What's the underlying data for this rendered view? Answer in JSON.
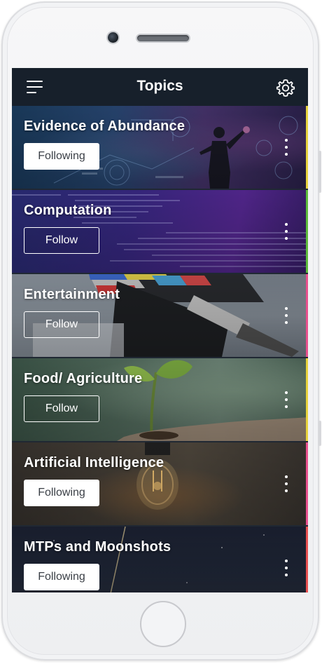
{
  "header": {
    "title": "Topics",
    "menu_icon": "hamburger-menu-icon",
    "settings_icon": "gear-icon",
    "background": "#17202b"
  },
  "topics": [
    {
      "title": "Evidence of Abundance",
      "button_label": "Following",
      "following": true,
      "accent": "#e7d23c",
      "theme": "futuristic-ui-woman"
    },
    {
      "title": "Computation",
      "button_label": "Follow",
      "following": false,
      "accent": "#5cbc3b",
      "theme": "purple-code-screen"
    },
    {
      "title": "Entertainment",
      "button_label": "Follow",
      "following": false,
      "accent": "#e8508e",
      "theme": "film-clapperboard"
    },
    {
      "title": "Food/ Agriculture",
      "button_label": "Follow",
      "following": false,
      "accent": "#e7d23c",
      "theme": "seedling-in-hand"
    },
    {
      "title": "Artificial Intelligence",
      "button_label": "Following",
      "following": true,
      "accent": "#e8508e",
      "theme": "light-bulb"
    },
    {
      "title": "MTPs and Moonshots",
      "button_label": "Following",
      "following": true,
      "accent": "#e85050",
      "theme": "night-sky-streak"
    }
  ],
  "colors": {
    "screen": "#1d2430",
    "following_button_bg": "#ffffff",
    "following_button_text": "#3a3f46",
    "follow_button_border": "#ffffff"
  }
}
